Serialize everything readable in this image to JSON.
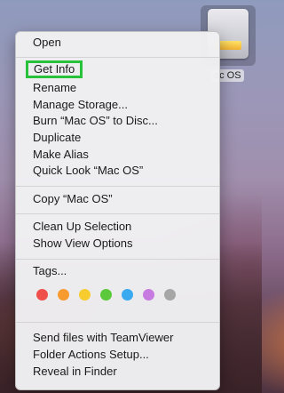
{
  "desktop": {
    "disk_label": "ac OS"
  },
  "menu": {
    "open": "Open",
    "get_info": "Get Info",
    "rename": "Rename",
    "manage_storage": "Manage Storage...",
    "burn": "Burn “Mac OS” to Disc...",
    "duplicate": "Duplicate",
    "make_alias": "Make Alias",
    "quick_look": "Quick Look “Mac OS”",
    "copy": "Copy “Mac OS”",
    "clean_up": "Clean Up Selection",
    "show_view_options": "Show View Options",
    "tags": "Tags...",
    "tag_colors": [
      "#f0504c",
      "#f79b2e",
      "#f6cc2f",
      "#5cc83b",
      "#3aaaf0",
      "#c77ae0",
      "#a6a6a6"
    ],
    "send_teamviewer": "Send files with TeamViewer",
    "folder_actions": "Folder Actions Setup...",
    "reveal_finder": "Reveal in Finder",
    "highlight_color": "#27c13a"
  }
}
